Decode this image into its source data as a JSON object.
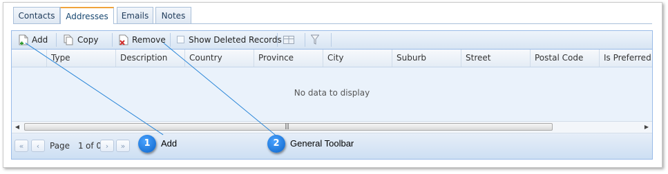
{
  "tabs": [
    {
      "label": "Contacts",
      "active": false
    },
    {
      "label": "Addresses",
      "active": true
    },
    {
      "label": "Emails",
      "active": false
    },
    {
      "label": "Notes",
      "active": false
    }
  ],
  "toolbar": {
    "add_label": "Add",
    "copy_label": "Copy",
    "remove_label": "Remove",
    "show_deleted_label": "Show Deleted Records",
    "show_deleted_checked": false
  },
  "columns": [
    "Type",
    "Description",
    "Country",
    "Province",
    "City",
    "Suburb",
    "Street",
    "Postal Code",
    "Is Preferred"
  ],
  "grid": {
    "empty_text": "No data to display"
  },
  "pager": {
    "page_label": "Page",
    "current_page": "1",
    "of_label": "of 0"
  },
  "callouts": [
    {
      "number": "1",
      "label": "Add"
    },
    {
      "number": "2",
      "label": "General Toolbar"
    }
  ],
  "colors": {
    "accent": "#0b63c9",
    "panel_border": "#99bbe8",
    "active_tab": "#f0a33b"
  }
}
